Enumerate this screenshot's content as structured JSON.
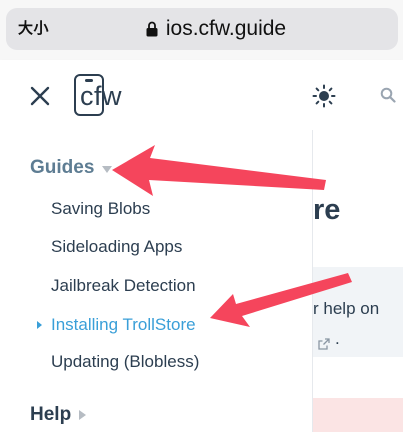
{
  "browser": {
    "text_size_label": "大小",
    "url": "ios.cfw.guide"
  },
  "header": {
    "logo_text": "cfw",
    "icons": [
      "close-icon",
      "sun-icon",
      "search-icon"
    ]
  },
  "sidebar": {
    "groups": [
      {
        "label": "Guides",
        "expanded": true,
        "items": [
          {
            "label": "Saving Blobs",
            "active": false
          },
          {
            "label": "Sideloading Apps",
            "active": false
          },
          {
            "label": "Jailbreak Detection",
            "active": false
          },
          {
            "label": "Installing TrollStore",
            "active": true
          },
          {
            "label": "Updating (Blobless)",
            "active": false
          }
        ]
      },
      {
        "label": "Help",
        "expanded": false,
        "items": []
      }
    ]
  },
  "content": {
    "heading_fragment": "re",
    "text_fragment": "r help on",
    "trailing_period": "."
  },
  "colors": {
    "active_link": "#3a9fd8",
    "group_active": "#5e7d93",
    "text": "#2c3e50",
    "annotation_arrow": "#f5455c"
  }
}
